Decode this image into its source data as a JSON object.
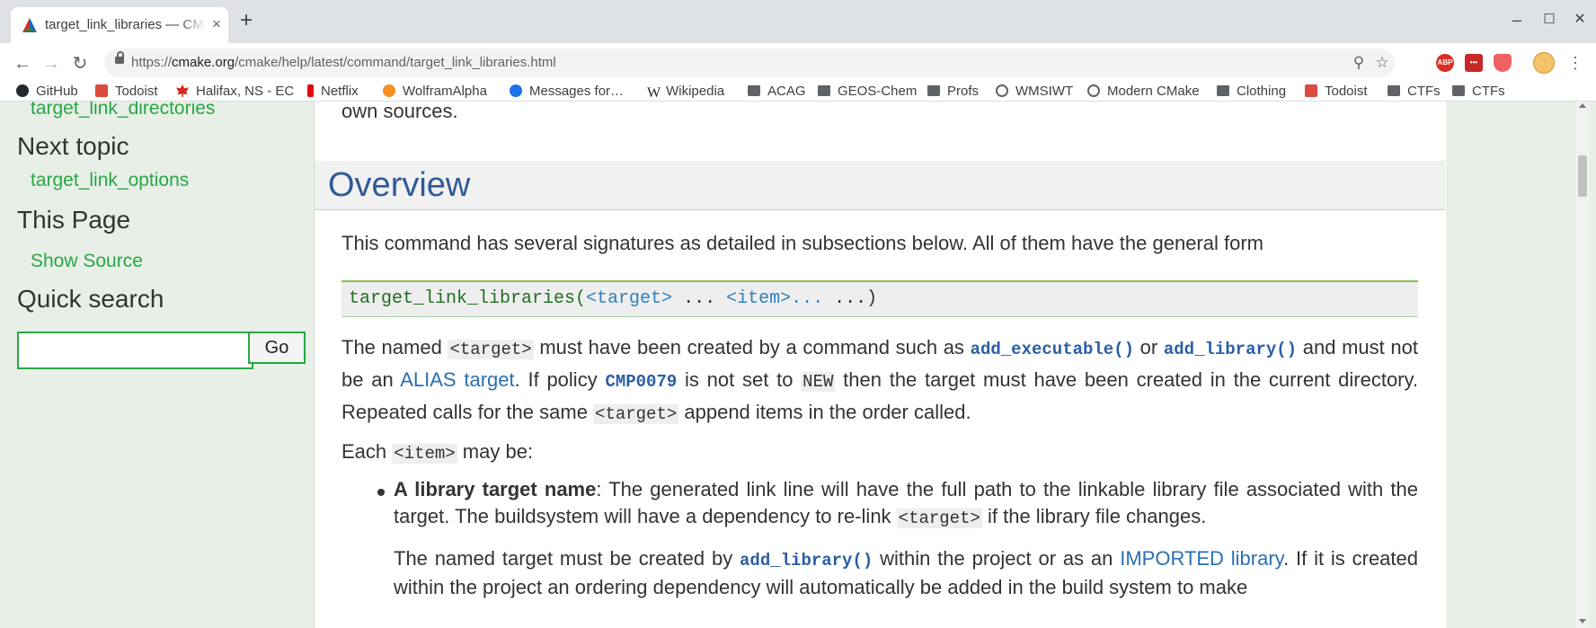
{
  "browser": {
    "tab_title": "target_link_libraries — CMake",
    "tab_close": "×",
    "new_tab": "+",
    "url_scheme": "https://",
    "url_host": "cmake.org",
    "url_path": "/cmake/help/latest/command/target_link_libraries.html",
    "win_minimize": "–",
    "win_maximize": "☐",
    "win_close": "✕",
    "nav": {
      "back": "←",
      "forward": "→",
      "reload": "↻"
    },
    "ext_labels": {
      "abp": "ABP"
    }
  },
  "bookmarks": [
    {
      "label": "GitHub",
      "icon": "github-icon",
      "color": "#24292e"
    },
    {
      "label": "Todoist",
      "icon": "todoist-icon",
      "color": "#db4c3f"
    },
    {
      "label": "Halifax, NS - EC",
      "icon": "maple-leaf-icon",
      "color": "#d52b1e"
    },
    {
      "label": "Netflix",
      "icon": "netflix-icon",
      "color": "#e50914"
    },
    {
      "label": "WolframAlpha",
      "icon": "wolfram-icon",
      "color": "#f78e1e"
    },
    {
      "label": "Messages for…",
      "icon": "messages-icon",
      "color": "#1a73e8"
    },
    {
      "label": "Wikipedia",
      "icon": "wikipedia-icon",
      "color": "#202124"
    },
    {
      "label": "ACAG",
      "icon": "folder-icon",
      "color": "#5f6368"
    },
    {
      "label": "GEOS-Chem",
      "icon": "folder-icon",
      "color": "#5f6368"
    },
    {
      "label": "Profs",
      "icon": "folder-icon",
      "color": "#5f6368"
    },
    {
      "label": "WMSIWT",
      "icon": "globe-icon",
      "color": "#5f6368"
    },
    {
      "label": "Modern CMake",
      "icon": "globe-icon",
      "color": "#5f6368"
    },
    {
      "label": "Clothing",
      "icon": "folder-icon",
      "color": "#5f6368"
    },
    {
      "label": "Todoist",
      "icon": "todoist-icon",
      "color": "#db4c3f"
    },
    {
      "label": "CTFs",
      "icon": "folder-icon",
      "color": "#5f6368"
    },
    {
      "label": "CTFs",
      "icon": "folder-icon",
      "color": "#5f6368"
    }
  ],
  "sidebar": {
    "prev_link": "target_link_directories",
    "next_heading": "Next topic",
    "next_link": "target_link_options",
    "this_page_heading": "This Page",
    "show_source": "Show Source",
    "quick_search_heading": "Quick search",
    "search_value": "",
    "go_label": "Go"
  },
  "content": {
    "top_line": "own sources.",
    "heading": "Overview",
    "intro": "This command has several signatures as detailed in subsections below. All of them have the general form",
    "code": {
      "fn": "target_link_libraries(",
      "arg1": "<target>",
      "mid": " ... ",
      "arg2": "<item>...",
      "end": " ...)"
    },
    "p1": {
      "t1": "The named ",
      "lit_target": "<target>",
      "t2": " must have been created by a command such as ",
      "ref_exec": "add_executable()",
      "t3": " or ",
      "ref_lib": "add_library()",
      "t4": " and must not be an ",
      "alias_link": "ALIAS target",
      "t5": ". If policy ",
      "ref_policy": "CMP0079",
      "t6": " is not set to ",
      "lit_new": "NEW",
      "t7": " then the target must have been created in the current directory. Repeated calls for the same ",
      "lit_target2": "<target>",
      "t8": " append items in the order called."
    },
    "p2": {
      "t1": "Each ",
      "lit_item": "<item>",
      "t2": " may be:"
    },
    "bullet1": {
      "bold": "A library target name",
      "t1": ": The generated link line will have the full path to the linkable library file associated with the target. The buildsystem will have a dependency to re-link ",
      "lit_target": "<target>",
      "t2": " if the library file changes."
    },
    "p3": {
      "t1": "The named target must be created by ",
      "ref_lib": "add_library()",
      "t2": " within the project or as an ",
      "imported_link": "IMPORTED library",
      "t3": ". If it is created within the project an ordering dependency will automatically be added in the build system to make"
    }
  }
}
